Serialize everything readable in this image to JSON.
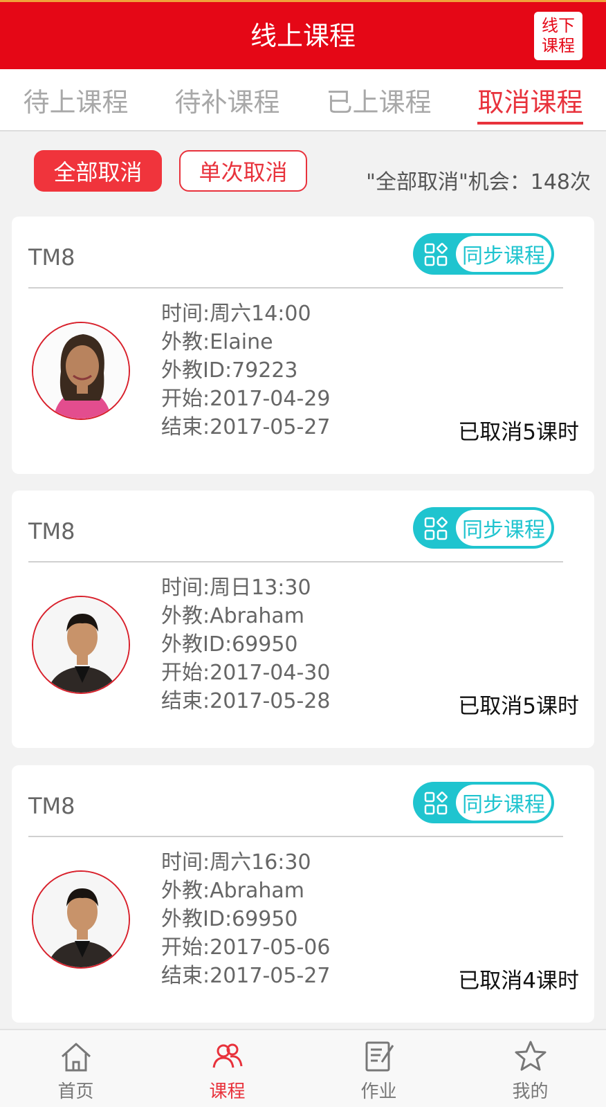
{
  "header": {
    "title": "线上课程",
    "offline_line1": "线下",
    "offline_line2": "课程"
  },
  "tabs": [
    {
      "label": "待上课程",
      "active": false
    },
    {
      "label": "待补课程",
      "active": false
    },
    {
      "label": "已上课程",
      "active": false
    },
    {
      "label": "取消课程",
      "active": true
    }
  ],
  "filters": {
    "all_label": "全部取消",
    "single_label": "单次取消",
    "chance_text": "\"全部取消\"机会：148次"
  },
  "colors": {
    "brand_red": "#e50716",
    "accent_red": "#e8323c",
    "teal": "#1fc4cf"
  },
  "courses": [
    {
      "code": "TM8",
      "sync_label": "同步课程",
      "time": "时间:周六14:00",
      "teacher": "外教:Elaine",
      "teacher_id": "外教ID:79223",
      "start": "开始:2017-04-29",
      "end": "结束:2017-05-27",
      "cancelled": "已取消5课时"
    },
    {
      "code": "TM8",
      "sync_label": "同步课程",
      "time": "时间:周日13:30",
      "teacher": "外教:Abraham",
      "teacher_id": "外教ID:69950",
      "start": "开始:2017-04-30",
      "end": "结束:2017-05-28",
      "cancelled": "已取消5课时"
    },
    {
      "code": "TM8",
      "sync_label": "同步课程",
      "time": "时间:周六16:30",
      "teacher": "外教:Abraham",
      "teacher_id": "外教ID:69950",
      "start": "开始:2017-05-06",
      "end": "结束:2017-05-27",
      "cancelled": "已取消4课时"
    }
  ],
  "nav": [
    {
      "label": "首页",
      "icon": "home-icon",
      "active": false
    },
    {
      "label": "课程",
      "icon": "people-icon",
      "active": true
    },
    {
      "label": "作业",
      "icon": "edit-document-icon",
      "active": false
    },
    {
      "label": "我的",
      "icon": "star-icon",
      "active": false
    }
  ]
}
